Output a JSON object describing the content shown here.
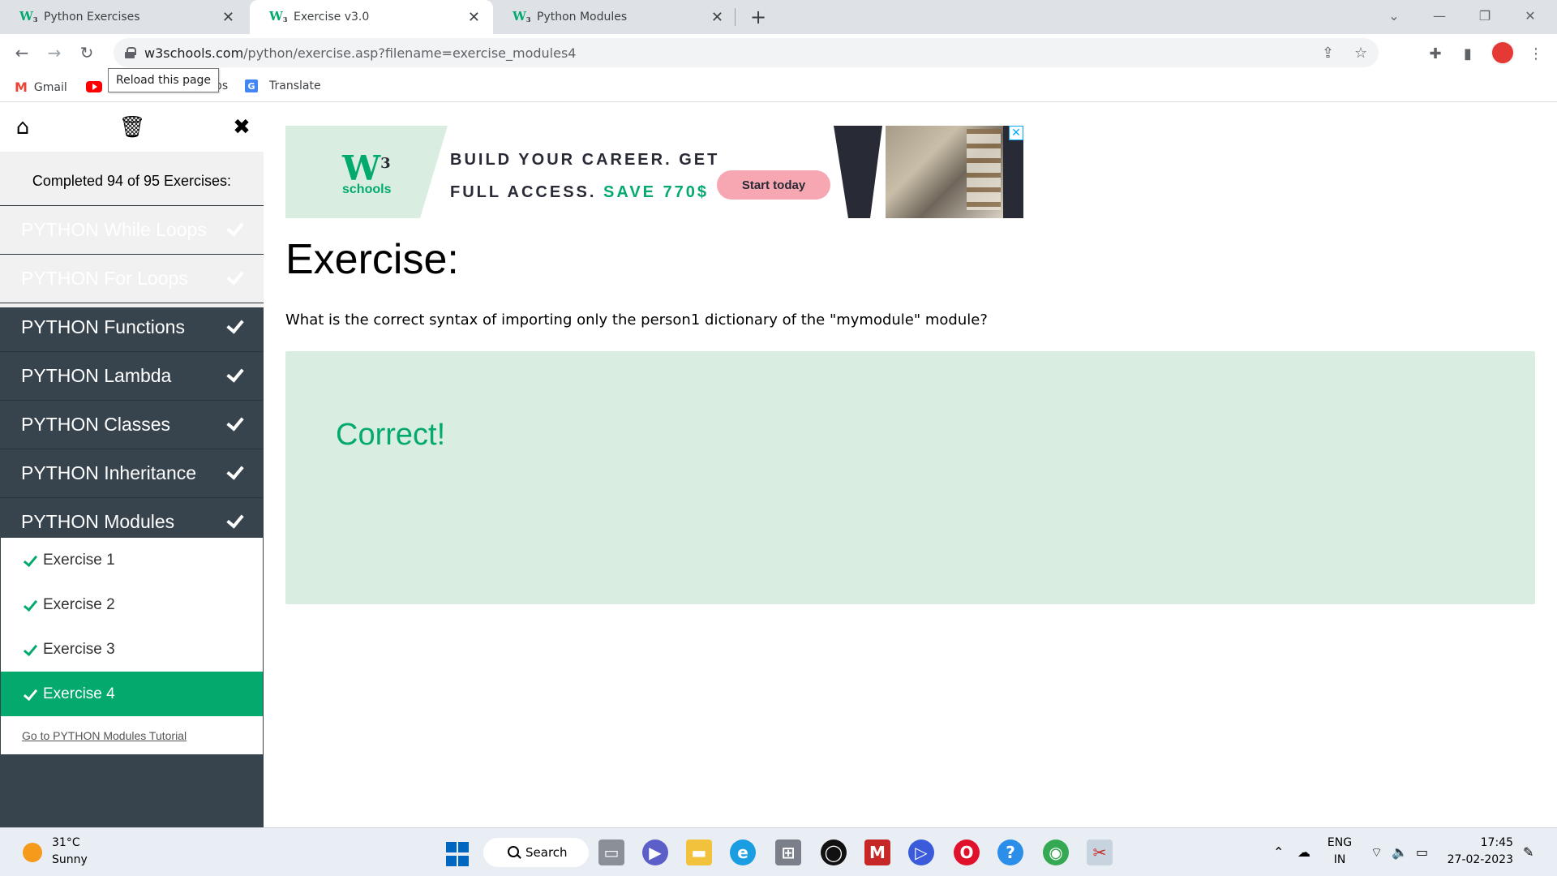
{
  "browser": {
    "tabs": [
      {
        "title": "Python Exercises",
        "active": false
      },
      {
        "title": "Exercise v3.0",
        "active": true
      },
      {
        "title": "Python Modules",
        "active": false
      }
    ],
    "url_host": "w3schools.com",
    "url_path": "/python/exercise.asp?filename=exercise_modules4",
    "bookmarks": {
      "gmail": "Gmail",
      "partial": "ps",
      "translate": "Translate"
    },
    "tooltip": "Reload this page"
  },
  "sidebar": {
    "progress_text": "Completed 94 of 95 Exercises:",
    "chapters": [
      {
        "label": "PYTHON While Loops"
      },
      {
        "label": "PYTHON For Loops"
      },
      {
        "label": "PYTHON Functions"
      },
      {
        "label": "PYTHON Lambda"
      },
      {
        "label": "PYTHON Classes"
      },
      {
        "label": "PYTHON Inheritance"
      },
      {
        "label": "PYTHON Modules"
      }
    ],
    "exercises": [
      {
        "label": "Exercise 1"
      },
      {
        "label": "Exercise 2"
      },
      {
        "label": "Exercise 3"
      },
      {
        "label": "Exercise 4"
      }
    ],
    "tutorial_link": "Go to PYTHON Modules Tutorial"
  },
  "ad": {
    "logo_sub": "schools",
    "headline_line1": "BUILD YOUR CAREER. GET",
    "headline_line2": "FULL ACCESS.",
    "headline_save": "SAVE 770$",
    "cta": "Start today"
  },
  "main": {
    "heading": "Exercise:",
    "question": "What is the correct syntax of importing only the person1 dictionary of the \"mymodule\" module?",
    "result": "Correct!"
  },
  "taskbar": {
    "temperature": "31°C",
    "weather": "Sunny",
    "search_label": "Search",
    "lang_line1": "ENG",
    "lang_line2": "IN",
    "time": "17:45",
    "date": "27-02-2023"
  },
  "colors": {
    "accent_green": "#04aa6d",
    "sidebar_dark": "#38444d",
    "answer_bg": "#d9eee1"
  }
}
